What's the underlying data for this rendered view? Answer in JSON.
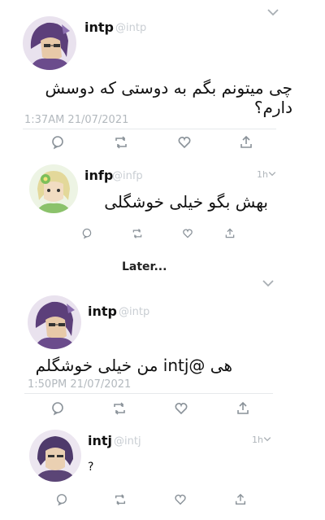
{
  "tweets": [
    {
      "name": "intp",
      "handle": "@intp",
      "text": "چی میتونم بگم به دوستی که دوسش دارم؟",
      "timestamp": "1:37AM 21/07/2021"
    },
    {
      "name": "infp",
      "handle": "@infp",
      "time_ago": "1h",
      "text": "بهش بگو خیلی خوشگلی"
    },
    {
      "name": "intp",
      "handle": "@intp",
      "text": "هی @intj من خیلی خوشگلم",
      "timestamp": "1:50PM 21/07/2021"
    },
    {
      "name": "intj",
      "handle": "@intj",
      "time_ago": "1h",
      "text": "?"
    }
  ],
  "divider_text": "Later...",
  "icons": [
    "reply-icon",
    "retweet-icon",
    "like-icon",
    "share-icon",
    "chevron-down-icon"
  ]
}
